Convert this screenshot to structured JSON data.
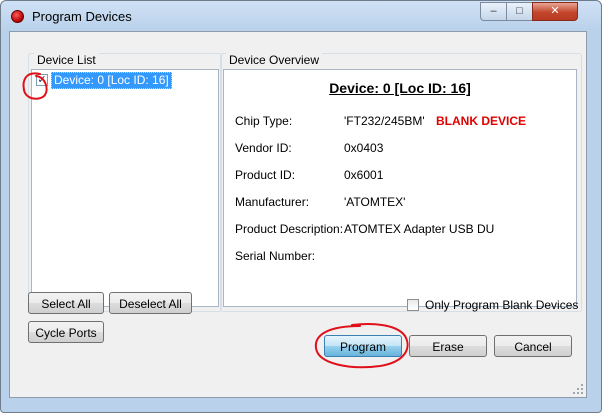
{
  "window": {
    "title": "Program Devices",
    "controls": {
      "minimize": "–",
      "maximize": "□",
      "close": "✕"
    }
  },
  "device_list": {
    "group_title": "Device List",
    "items": [
      {
        "label": "Device: 0 [Loc ID: 16]",
        "checked": true
      }
    ]
  },
  "device_overview": {
    "group_title": "Device Overview",
    "heading": "Device: 0 [Loc ID: 16]",
    "blank_tag": "BLANK DEVICE",
    "fields": [
      {
        "label": "Chip Type:",
        "value": "'FT232/245BM'"
      },
      {
        "label": "Vendor ID:",
        "value": "0x0403"
      },
      {
        "label": "Product ID:",
        "value": "0x6001"
      },
      {
        "label": "Manufacturer:",
        "value": "'ATOMTEX'"
      },
      {
        "label": "Product Description:",
        "value": "ATOMTEX Adapter USB DU"
      },
      {
        "label": "Serial Number:",
        "value": ""
      }
    ]
  },
  "buttons": {
    "select_all": "Select All",
    "deselect_all": "Deselect All",
    "cycle_ports": "Cycle Ports",
    "program": "Program",
    "erase": "Erase",
    "cancel": "Cancel"
  },
  "options": {
    "only_program_blank": "Only Program Blank Devices",
    "only_program_blank_checked": false
  },
  "colors": {
    "annotation": "#e0101a",
    "blank_tag": "#e00000",
    "selection": "#3399ff"
  }
}
